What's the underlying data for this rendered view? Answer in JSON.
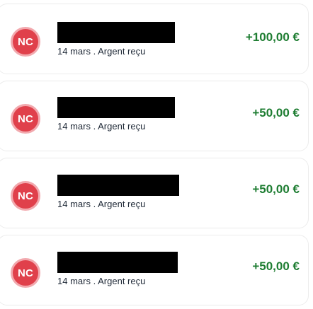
{
  "transactions": [
    {
      "avatar_initials": "NC",
      "name": "",
      "date": "14 mars",
      "separator": ".",
      "type": "Argent reçu",
      "amount": "+100,00 €"
    },
    {
      "avatar_initials": "NC",
      "name": "",
      "date": "14 mars",
      "separator": ".",
      "type": "Argent reçu",
      "amount": "+50,00 €"
    },
    {
      "avatar_initials": "NC",
      "name": "",
      "date": "14 mars",
      "separator": ".",
      "type": "Argent reçu",
      "amount": "+50,00 €"
    },
    {
      "avatar_initials": "NC",
      "name": "",
      "date": "14 mars",
      "separator": ".",
      "type": "Argent reçu",
      "amount": "+50,00 €"
    }
  ],
  "colors": {
    "avatar_bg": "#e0404b",
    "avatar_ring": "#f2a9ae",
    "amount_positive": "#1e7d32",
    "redaction": "#000000"
  }
}
